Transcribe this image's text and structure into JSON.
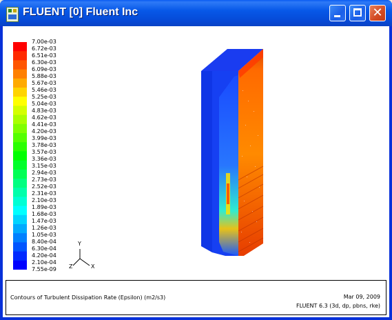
{
  "window": {
    "title": "FLUENT [0] Fluent Inc",
    "controls": {
      "minimize": "minimize",
      "maximize": "maximize",
      "close": "✕"
    }
  },
  "legend": {
    "labels": [
      "7.00e-03",
      "6.72e-03",
      "6.51e-03",
      "6.30e-03",
      "6.09e-03",
      "5.88e-03",
      "5.67e-03",
      "5.46e-03",
      "5.25e-03",
      "5.04e-03",
      "4.83e-03",
      "4.62e-03",
      "4.41e-03",
      "4.20e-03",
      "3.99e-03",
      "3.78e-03",
      "3.57e-03",
      "3.36e-03",
      "3.15e-03",
      "2.94e-03",
      "2.73e-03",
      "2.52e-03",
      "2.31e-03",
      "2.10e-03",
      "1.89e-03",
      "1.68e-03",
      "1.47e-03",
      "1.26e-03",
      "1.05e-03",
      "8.40e-04",
      "6.30e-04",
      "4.20e-04",
      "2.10e-04",
      "7.55e-09"
    ],
    "colors": [
      "#ff0000",
      "#ff2a00",
      "#ff5500",
      "#ff8000",
      "#ffaa00",
      "#ffd400",
      "#ffff00",
      "#d4ff00",
      "#aaff00",
      "#80ff00",
      "#55ff00",
      "#2aff00",
      "#00ff00",
      "#00ff2a",
      "#00ff55",
      "#00ff80",
      "#00ffaa",
      "#00ffd4",
      "#00ffff",
      "#00d4ff",
      "#00aaff",
      "#0080ff",
      "#0055ff",
      "#002aff",
      "#0000ff"
    ]
  },
  "axes": {
    "y": "Y",
    "z": "Z",
    "x": "X"
  },
  "info": {
    "description": "Contours of Turbulent Dissipation Rate (Epsilon) (m2/s3)",
    "date": "Mar 09, 2009",
    "version": "FLUENT 6.3 (3d, dp, pbns, rke)"
  }
}
